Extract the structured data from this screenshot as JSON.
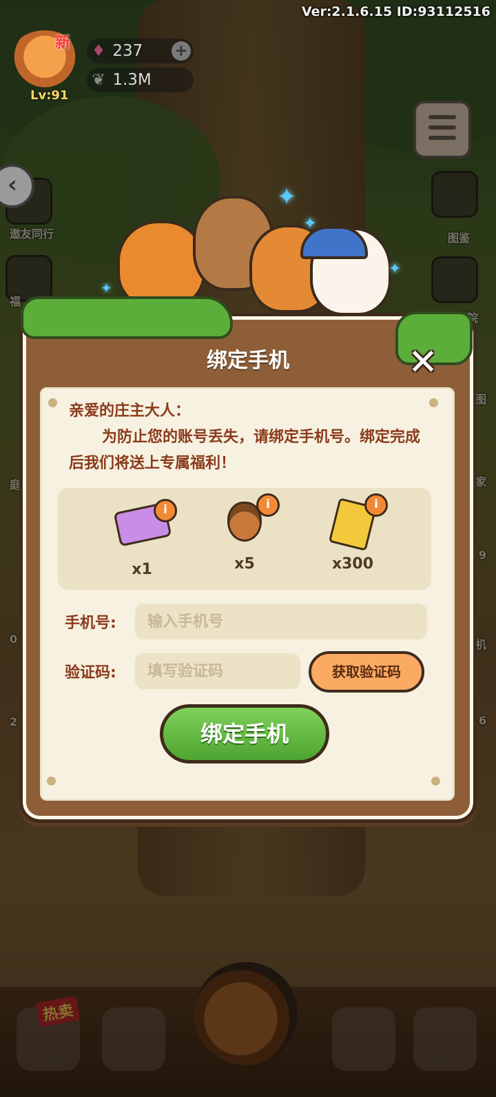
{
  "version_text": "Ver:2.1.6.15 ID:93112516",
  "player": {
    "level": "Lv:91",
    "new_badge": "新",
    "gems": "237",
    "seeds": "1.3M"
  },
  "background": {
    "left_labels": [
      "遨友同行",
      "福",
      "庭",
      "0",
      "2"
    ],
    "right_labels": [
      "图鉴",
      "学院",
      "图",
      "家",
      "9",
      "机",
      "6"
    ],
    "hot_tag": "热卖"
  },
  "dialog": {
    "title": "绑定手机",
    "close_icon": "close-icon",
    "greeting": "亲爱的庄主大人：",
    "message": "为防止您的账号丢失，请绑定手机号。绑定完成后我们将送上专属福利！",
    "rewards": [
      {
        "icon": "ticket-icon",
        "count": "x1"
      },
      {
        "icon": "acorn-icon",
        "count": "x5"
      },
      {
        "icon": "coupon-icon",
        "count": "x300"
      }
    ],
    "phone_label": "手机号:",
    "phone_placeholder": "输入手机号",
    "code_label": "验证码:",
    "code_placeholder": "填写验证码",
    "get_code_button": "获取验证码",
    "bind_button": "绑定手机"
  },
  "colors": {
    "dialog_brown": "#8d5e37",
    "panel_cream": "#f6f1e0",
    "text_brown": "#8b3a1c",
    "green_button": "#4da531",
    "orange_button": "#fbaa63",
    "info_orange": "#f28a35"
  }
}
